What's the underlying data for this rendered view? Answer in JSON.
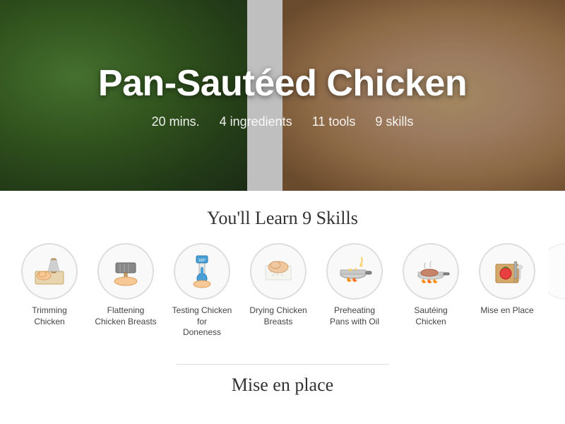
{
  "hero": {
    "title": "Pan-Sautéed Chicken",
    "meta": {
      "time": "20 mins.",
      "ingredients": "4 ingredients",
      "tools": "11 tools",
      "skills": "9 skills"
    }
  },
  "skills_section": {
    "heading": "You'll Learn 9 Skills",
    "skills": [
      {
        "id": "trimming",
        "label": "Trimming\nChicken"
      },
      {
        "id": "flattening",
        "label": "Flattening\nChicken Breasts"
      },
      {
        "id": "testing",
        "label": "Testing Chicken for\nDoneness"
      },
      {
        "id": "drying",
        "label": "Drying Chicken\nBreasts"
      },
      {
        "id": "preheating",
        "label": "Preheating\nPans with Oil"
      },
      {
        "id": "sauteing",
        "label": "Sautéing\nChicken"
      },
      {
        "id": "mise",
        "label": "Mise en Place"
      }
    ]
  },
  "mise_section": {
    "heading": "Mise en place"
  }
}
